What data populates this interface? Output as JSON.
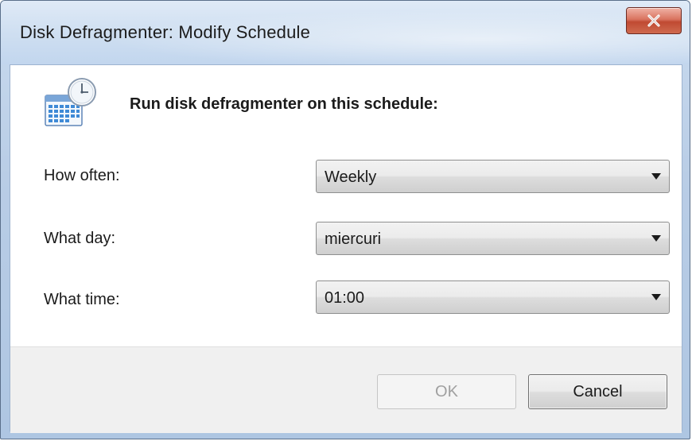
{
  "window": {
    "title": "Disk Defragmenter: Modify Schedule"
  },
  "header": {
    "icon": "calendar-clock-icon",
    "text": "Run disk defragmenter on this schedule:"
  },
  "schedule": {
    "how_often": {
      "label": "How often:",
      "value": "Weekly"
    },
    "what_day": {
      "label": "What day:",
      "value": "miercuri"
    },
    "what_time": {
      "label": "What time:",
      "value": "01:00"
    }
  },
  "buttons": {
    "ok_label": "OK",
    "ok_enabled": false,
    "cancel_label": "Cancel"
  },
  "colors": {
    "close_button": "#c9563f",
    "title_bar": "#c9dbef",
    "footer": "#f0f0f0"
  }
}
